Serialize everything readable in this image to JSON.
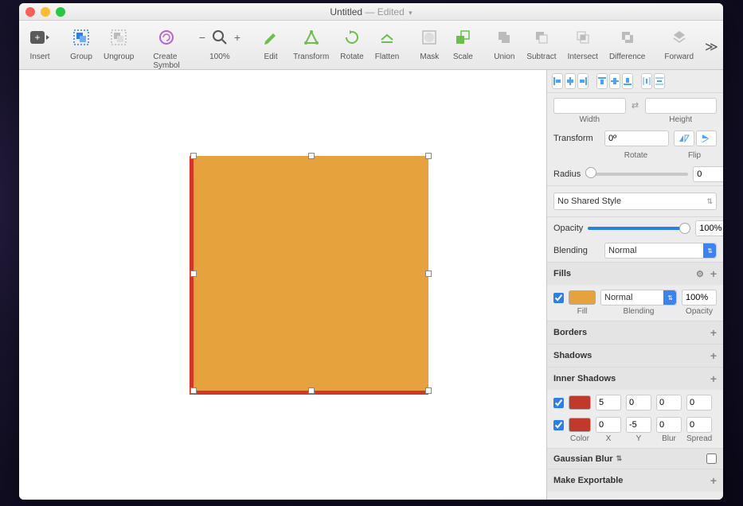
{
  "title": {
    "name": "Untitled",
    "edited": "— Edited"
  },
  "toolbar": {
    "insert": "Insert",
    "group": "Group",
    "ungroup": "Ungroup",
    "create_symbol": "Create Symbol",
    "zoom": "100%",
    "edit": "Edit",
    "transform": "Transform",
    "rotate": "Rotate",
    "flatten": "Flatten",
    "mask": "Mask",
    "scale": "Scale",
    "union": "Union",
    "subtract": "Subtract",
    "intersect": "Intersect",
    "difference": "Difference",
    "forward": "Forward"
  },
  "inspector": {
    "size": {
      "width_label": "Width",
      "height_label": "Height"
    },
    "transform": {
      "label": "Transform",
      "rotate": "0º",
      "rotate_label": "Rotate",
      "flip_label": "Flip"
    },
    "radius": {
      "label": "Radius",
      "value": "0"
    },
    "shared_style": "No Shared Style",
    "opacity": {
      "label": "Opacity",
      "value": "100%"
    },
    "blending": {
      "label": "Blending",
      "value": "Normal"
    },
    "fills": {
      "title": "Fills",
      "fill_color": "#e6a23c",
      "blend": "Normal",
      "opacity": "100%",
      "fill_label": "Fill",
      "blend_label": "Blending",
      "opacity_label": "Opacity"
    },
    "borders": {
      "title": "Borders"
    },
    "shadows": {
      "title": "Shadows"
    },
    "inner_shadows": {
      "title": "Inner Shadows",
      "rows": [
        {
          "color": "#c0392b",
          "x": "5",
          "y": "0",
          "blur": "0",
          "spread": "0"
        },
        {
          "color": "#c0392b",
          "x": "0",
          "y": "-5",
          "blur": "0",
          "spread": "0"
        }
      ],
      "labels": {
        "color": "Color",
        "x": "X",
        "y": "Y",
        "blur": "Blur",
        "spread": "Spread"
      }
    },
    "gaussian_blur": "Gaussian Blur",
    "make_exportable": "Make Exportable"
  }
}
